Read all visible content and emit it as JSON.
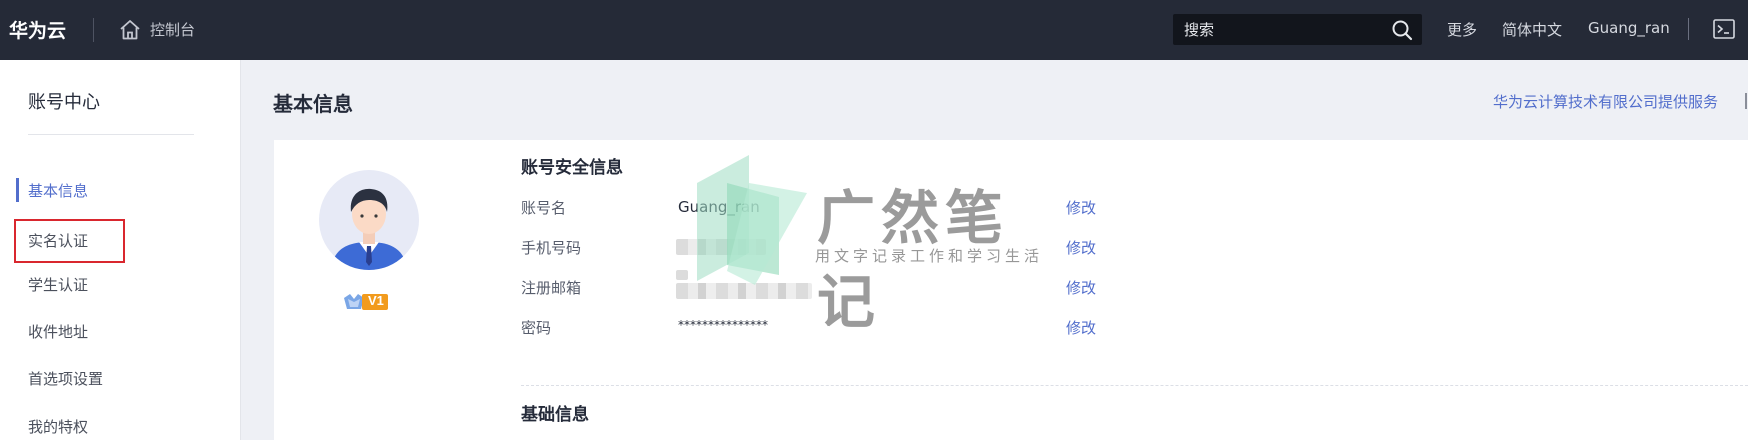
{
  "header": {
    "brand": "华为云",
    "console_label": "控制台",
    "search_placeholder": "搜索",
    "more_label": "更多",
    "language_label": "简体中文",
    "username": "Guang_ran"
  },
  "sidebar": {
    "title": "账号中心",
    "items": [
      {
        "label": "基本信息",
        "active": true
      },
      {
        "label": "实名认证",
        "highlighted": true
      },
      {
        "label": "学生认证"
      },
      {
        "label": "收件地址"
      },
      {
        "label": "首选项设置"
      },
      {
        "label": "我的特权"
      }
    ]
  },
  "main": {
    "title": "基本信息",
    "provider_text": "华为云计算技术有限公司提供服务",
    "level_badge": "V1",
    "security_section": {
      "title": "账号安全信息",
      "fields": [
        {
          "label": "账号名",
          "value": "Guang_ran",
          "edit": "修改"
        },
        {
          "label": "手机号码",
          "value": "",
          "edit": "修改"
        },
        {
          "label": "注册邮箱",
          "value": "",
          "edit": "修改"
        },
        {
          "label": "密码",
          "value": "***************",
          "edit": "修改"
        }
      ]
    },
    "basic_section": {
      "title": "基础信息"
    }
  },
  "watermark": {
    "title": "广然笔记",
    "subtitle": "用文字记录工作和学习生活"
  },
  "colors": {
    "topbar_bg": "#252a37",
    "accent": "#526ecc",
    "highlight_border": "#d9272e",
    "page_bg": "#eef0f5"
  },
  "icons": [
    "home-icon",
    "search-icon",
    "terminal-icon",
    "avatar",
    "level-badge-icon"
  ]
}
